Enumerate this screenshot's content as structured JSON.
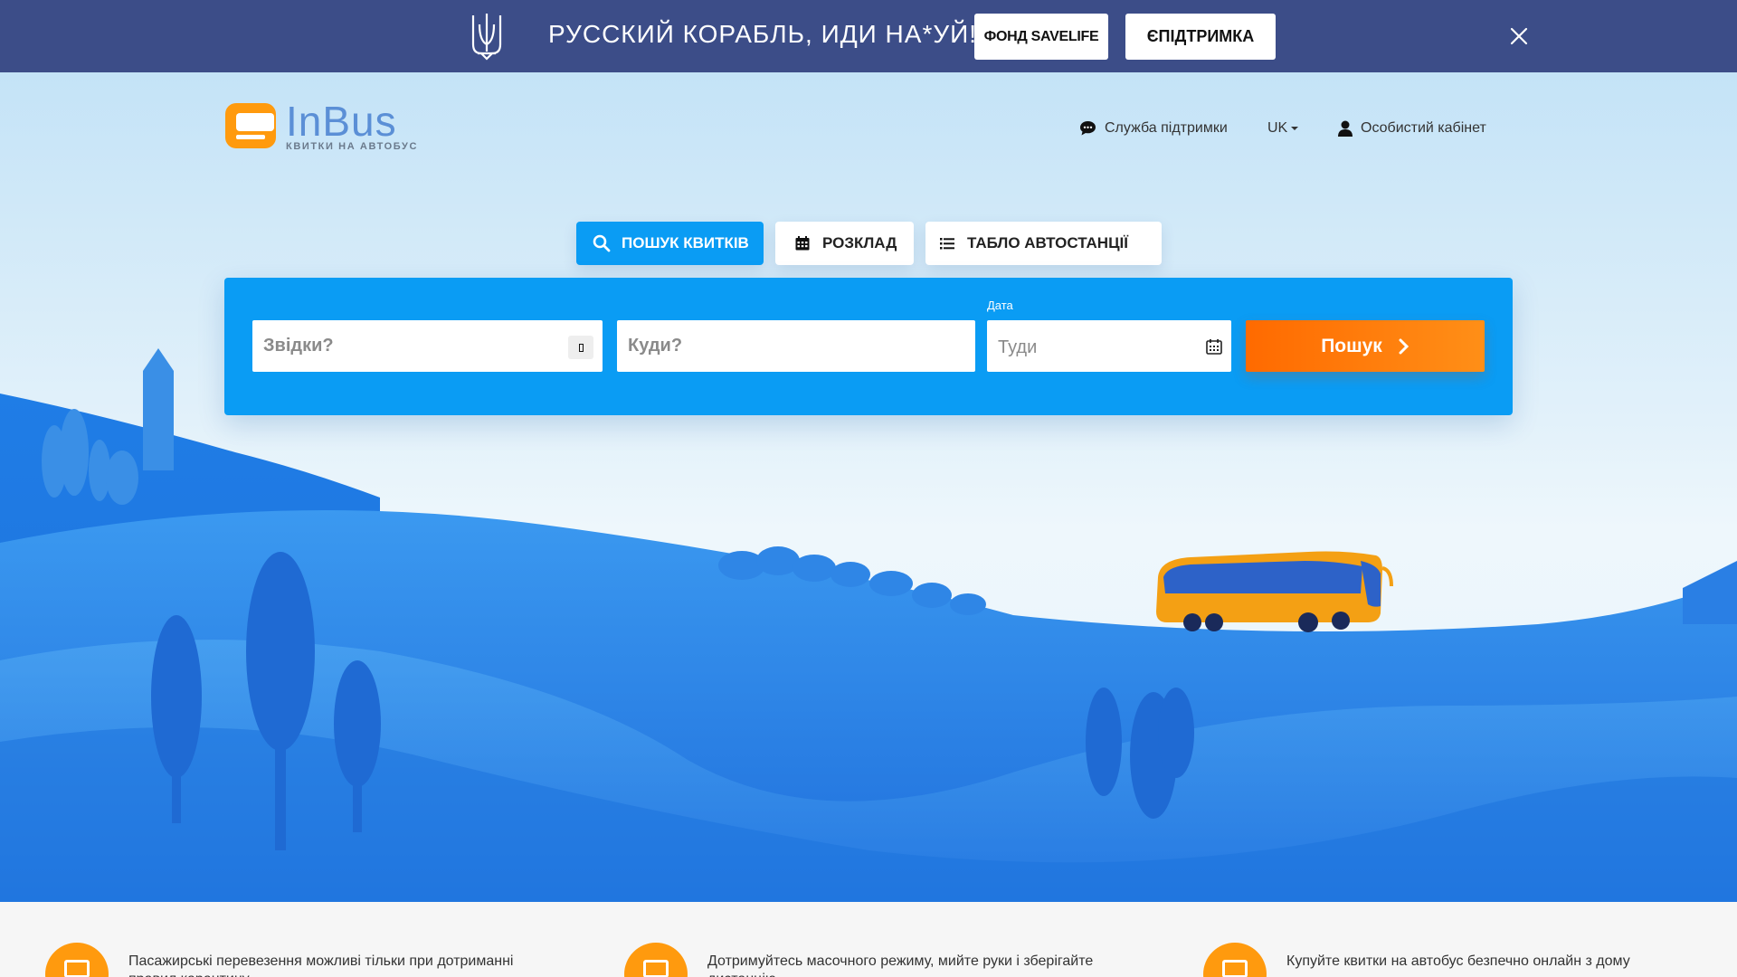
{
  "banner": {
    "slogan": "РУССКИЙ КОРАБЛЬ, ИДИ НА*УЙ!",
    "button_savelife": "ФОНД SAVELIFE",
    "button_esupport": "ЄПІДТРИМКА"
  },
  "logo": {
    "name": "InBus",
    "tagline": "КВИТКИ НА АВТОБУС"
  },
  "header": {
    "support": "Служба підтримки",
    "language": "UK",
    "cabinet": "Особистий кабінет"
  },
  "tabs": [
    {
      "label": "ПОШУК КВИТКІВ",
      "icon": "search-icon",
      "active": true
    },
    {
      "label": "РОЗКЛАД",
      "icon": "calendar-icon",
      "active": false
    },
    {
      "label": "ТАБЛО АВТОСТАНЦІЇ",
      "icon": "list-icon",
      "active": false
    }
  ],
  "search": {
    "from_placeholder": "Звідки?",
    "to_placeholder": "Куди?",
    "date_label": "Дата",
    "date_placeholder": "Туди",
    "submit_label": "Пошук"
  },
  "info": [
    {
      "text": "Пасажирські перевезення можливі тільки при дотриманні правил карантину",
      "icon": "bus-icon"
    },
    {
      "text": "Дотримуйтесь масочного режиму, мийте руки і зберігайте дистанцію",
      "icon": "mask-icon"
    },
    {
      "text": "Купуйте квитки на автобус безпечно онлайн з дому",
      "icon": "phone-icon"
    }
  ],
  "colors": {
    "banner": "#3c4d88",
    "primary": "#0a9cf4",
    "accent": "#ff7a00",
    "logo": "#ff9a0e"
  }
}
